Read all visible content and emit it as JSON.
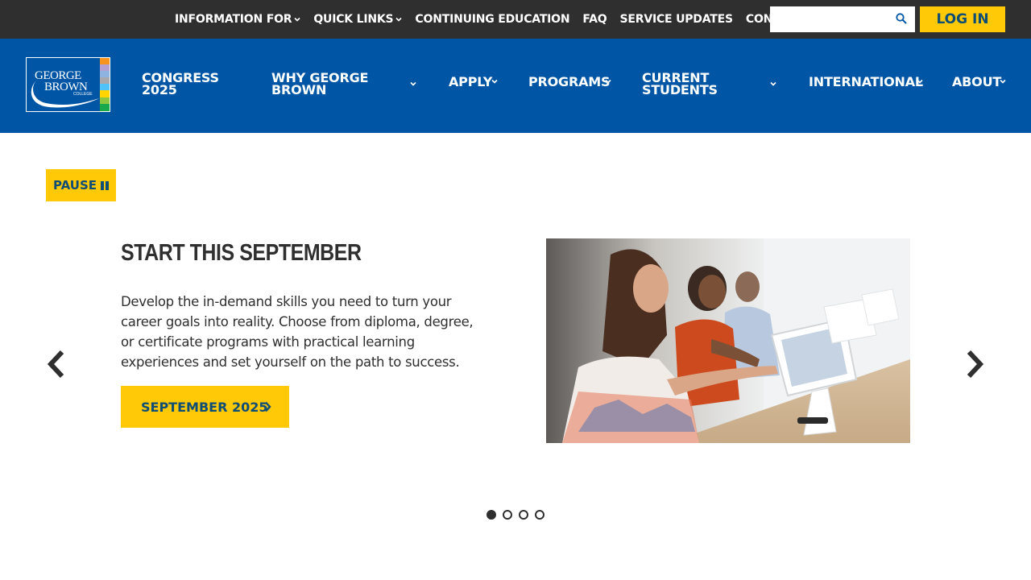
{
  "utility_bar": {
    "items": [
      {
        "label": "INFORMATION FOR",
        "has_dropdown": true
      },
      {
        "label": "QUICK LINKS",
        "has_dropdown": true
      },
      {
        "label": "CONTINUING EDUCATION",
        "has_dropdown": false
      },
      {
        "label": "FAQ",
        "has_dropdown": false
      },
      {
        "label": "SERVICE UPDATES",
        "has_dropdown": false
      },
      {
        "label": "CONTACT",
        "has_dropdown": true
      }
    ],
    "search": {
      "value": "",
      "placeholder": "",
      "icon": "search-icon"
    },
    "login_label": "LOG IN"
  },
  "logo": {
    "line1": "GEORGE",
    "line2": "BROWN",
    "line3": "COLLEGE"
  },
  "main_nav": {
    "items": [
      {
        "line1": "CONGRESS",
        "line2": "2025",
        "has_dropdown": false
      },
      {
        "line1": "WHY GEORGE",
        "line2": "BROWN",
        "has_dropdown": true
      },
      {
        "line1": "APPLY",
        "line2": "",
        "has_dropdown": true
      },
      {
        "line1": "PROGRAMS",
        "line2": "",
        "has_dropdown": true
      },
      {
        "line1": "CURRENT",
        "line2": "STUDENTS",
        "has_dropdown": true
      },
      {
        "line1": "INTERNATIONAL",
        "line2": "",
        "has_dropdown": true
      },
      {
        "line1": "ABOUT",
        "line2": "",
        "has_dropdown": true
      }
    ]
  },
  "carousel": {
    "pause_label": "PAUSE",
    "slide": {
      "title": "START THIS SEPTEMBER",
      "body": "Develop the in-demand skills you need to turn your career goals into reality. Choose from diploma, degree, or certificate programs with practical learning experiences and set yourself on the path to success.",
      "cta_label": "SEPTEMBER 2025"
    },
    "slide_count": 4,
    "active_slide": 1
  },
  "colors": {
    "utility_bg": "#2f2f2f",
    "nav_bg": "#0056a5",
    "accent_yellow": "#ffc907",
    "button_text": "#0e4d74",
    "body_text": "#2f2f2f"
  }
}
